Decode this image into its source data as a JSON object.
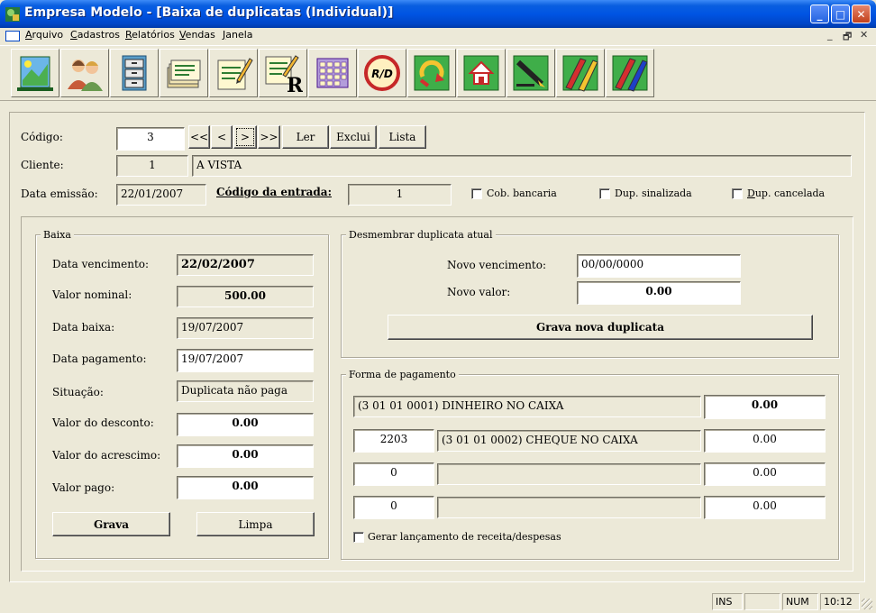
{
  "window": {
    "title": "Empresa Modelo - [Baixa de duplicatas (Individual)]",
    "min_glyph": "_",
    "max_glyph": "□",
    "close_glyph": "✕"
  },
  "menu": {
    "items": [
      "Arquivo",
      "Cadastros",
      "Relatórios",
      "Vendas",
      "Janela"
    ],
    "mdi_min": "_",
    "mdi_restore": "🗗",
    "mdi_close": "✕"
  },
  "toolbar": {
    "buttons": [
      {
        "icon": "map-icon"
      },
      {
        "icon": "people-icon"
      },
      {
        "icon": "cabinet-icon"
      },
      {
        "icon": "folders-icon"
      },
      {
        "icon": "edit-document-icon"
      },
      {
        "icon": "report-document-icon",
        "glyph": "R"
      },
      {
        "icon": "calendar-grid-icon"
      },
      {
        "icon": "rd-icon",
        "glyph": "R/D"
      },
      {
        "icon": "refresh-arrow-icon"
      },
      {
        "icon": "home-icon"
      },
      {
        "icon": "pen-icon"
      },
      {
        "icon": "pencil-chart-icon"
      },
      {
        "icon": "pencil-chart-blue-icon"
      }
    ]
  },
  "header": {
    "codigo_label": "Código:",
    "codigo_value": "3",
    "nav": [
      "<<",
      "<",
      ">",
      ">>"
    ],
    "ler": "Ler",
    "exclui": "Exclui",
    "lista": "Lista",
    "cliente_label": "Cliente:",
    "cliente_code": "1",
    "cliente_name": "A VISTA",
    "data_emissao_label": "Data emissão:",
    "data_emissao_value": "22/01/2007",
    "codigo_entrada_label": "Código da entrada:",
    "codigo_entrada_value": "1",
    "cob_bancaria": "Cob. bancaria",
    "dup_sinalizada": "Dup. sinalizada",
    "dup_cancelada": "Dup. cancelada"
  },
  "baixa": {
    "legend": "Baixa",
    "data_vencimento_label": "Data vencimento:",
    "data_vencimento_value": "22/02/2007",
    "valor_nominal_label": "Valor nominal:",
    "valor_nominal_value": "500.00",
    "data_baixa_label": "Data baixa:",
    "data_baixa_value": "19/07/2007",
    "data_pagamento_label": "Data pagamento:",
    "data_pagamento_value": "19/07/2007",
    "situacao_label": "Situação:",
    "situacao_value": "Duplicata não paga",
    "valor_desconto_label": "Valor do desconto:",
    "valor_desconto_value": "0.00",
    "valor_acrescimo_label": "Valor do acrescimo:",
    "valor_acrescimo_value": "0.00",
    "valor_pago_label": "Valor pago:",
    "valor_pago_value": "0.00",
    "grava": "Grava",
    "limpa": "Limpa"
  },
  "desmembrar": {
    "legend": "Desmembrar duplicata atual",
    "novo_vencimento_label": "Novo vencimento:",
    "novo_vencimento_value": "00/00/0000",
    "novo_valor_label": "Novo valor:",
    "novo_valor_value": "0.00",
    "grava_nova": "Grava nova duplicata"
  },
  "pagamento": {
    "legend": "Forma de pagamento",
    "row1_account": "(3 01 01 0001) DINHEIRO NO CAIXA",
    "row1_value": "0.00",
    "row2_code": "2203",
    "row2_account": "(3 01 01 0002) CHEQUE NO CAIXA",
    "row2_value": "0.00",
    "row3_code": "0",
    "row3_account": "",
    "row3_value": "0.00",
    "row4_code": "0",
    "row4_account": "",
    "row4_value": "0.00",
    "gerar_label": "Gerar lançamento de receita/despesas"
  },
  "status": {
    "ins": "INS",
    "blank": "",
    "num": "NUM",
    "time": "10:12"
  }
}
